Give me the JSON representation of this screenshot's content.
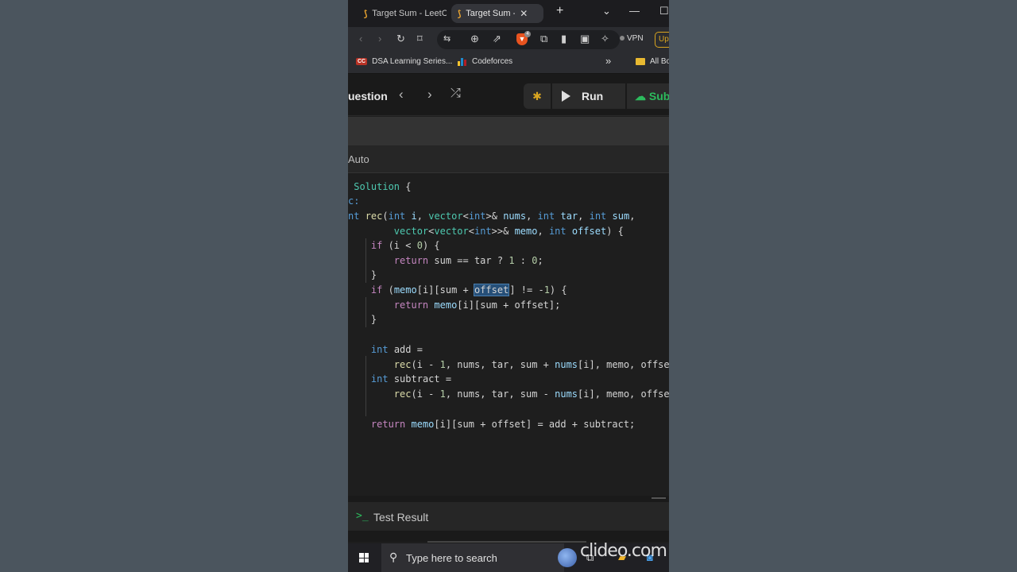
{
  "browser": {
    "tabs": [
      {
        "title": "Target Sum - LeetC",
        "active": false
      },
      {
        "title": "Target Sum - L",
        "active": true
      }
    ],
    "new_tab_label": "+",
    "vpn_label": "VPN",
    "upgrade_label": "Up",
    "brave_badge": "4",
    "bookmarks": [
      {
        "label": "DSA Learning Series...",
        "icon": "cc-icon"
      },
      {
        "label": "Codeforces",
        "icon": "codeforces-icon"
      }
    ],
    "all_bookmarks_label": "All Bo",
    "overflow_label": "»"
  },
  "leetcode": {
    "question_label": "uestion",
    "run_label": "Run",
    "submit_label": "Sub",
    "language_label": "Auto",
    "accent_color": "#2cbb5d"
  },
  "code": {
    "lines": [
      " Solution {",
      "c:",
      "nt rec(int i, vector<int>& nums, int tar, int sum,",
      "      vector<vector<int>>& memo, int offset) {",
      "  if (i < 0) {",
      "      return sum == tar ? 1 : 0;",
      "  }",
      "  if (memo[i][sum + offset] != -1) {",
      "      return memo[i][sum + offset];",
      "  }",
      "",
      "  int add =",
      "      rec(i - 1, nums, tar, sum + nums[i], memo, offse",
      "  int subtract =",
      "      rec(i - 1, nums, tar, sum - nums[i], memo, offse",
      "",
      "  return memo[i][sum + offset] = add + subtract;"
    ],
    "highlighted_word": "offset"
  },
  "test_panel": {
    "label": "Test Result"
  },
  "taskbar": {
    "search_placeholder": "Type here to search",
    "watermark": "clideo.com"
  }
}
